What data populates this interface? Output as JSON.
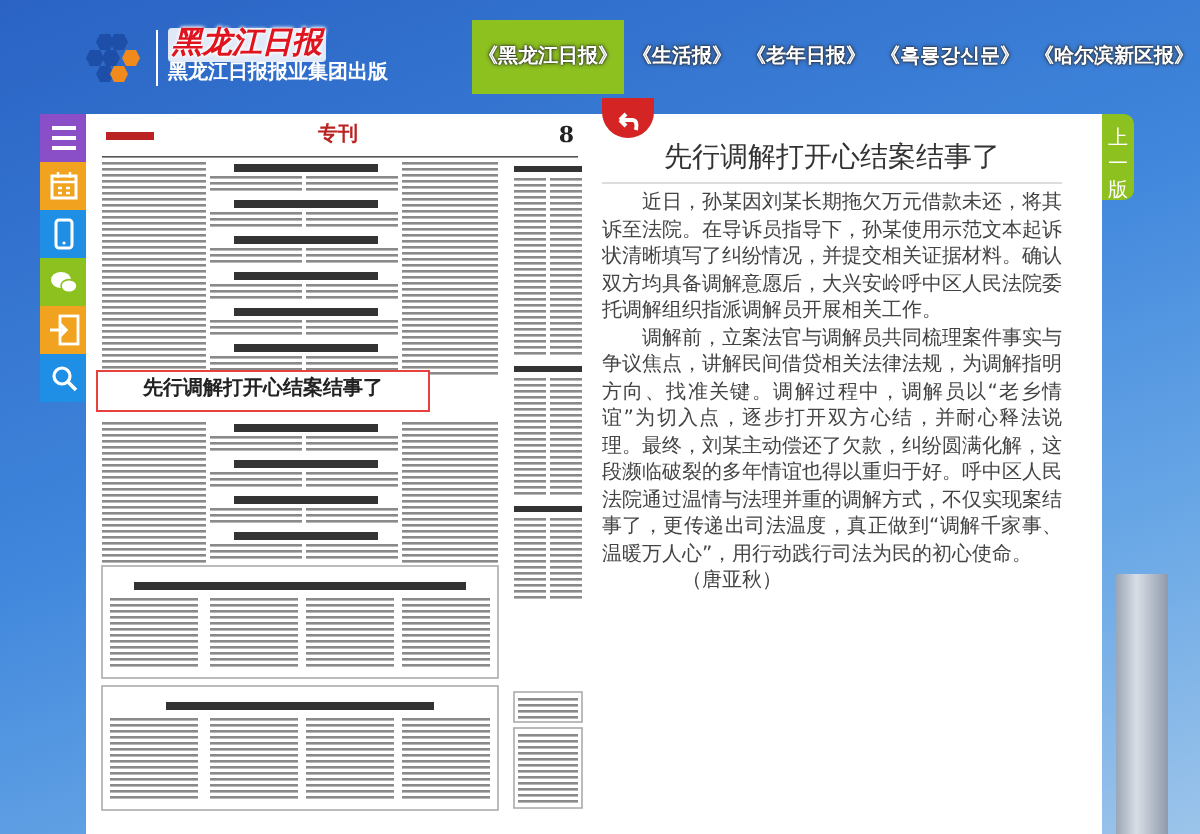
{
  "header": {
    "logo_title": "黑龙江日报",
    "logo_subtitle": "黑龙江日报报业集团出版"
  },
  "nav": [
    {
      "label": "《黑龙江日报》",
      "selected": true
    },
    {
      "label": "《生活报》",
      "selected": false
    },
    {
      "label": "《老年日报》",
      "selected": false
    },
    {
      "label": "《흑룡강신문》",
      "selected": false
    },
    {
      "label": "《哈尔滨新区报》",
      "selected": false
    }
  ],
  "toolbar": [
    {
      "kind": "menu"
    },
    {
      "kind": "calendar"
    },
    {
      "kind": "phone"
    },
    {
      "kind": "wechat"
    },
    {
      "kind": "past"
    },
    {
      "kind": "search"
    }
  ],
  "newspaper": {
    "section": "专刊",
    "page_number": "8",
    "highlighted_headline": "先行调解打开心结案结事了"
  },
  "article": {
    "title": "先行调解打开心结案结事了",
    "paragraphs": [
      "近日，孙某因刘某长期拖欠万元借款未还，将其诉至法院。在导诉员指导下，孙某使用示范文本起诉状清晰填写了纠纷情况，并提交相关证据材料。确认双方均具备调解意愿后，大兴安岭呼中区人民法院委托调解组织指派调解员开展相关工作。",
      "调解前，立案法官与调解员共同梳理案件事实与争议焦点，讲解民间借贷相关法律法规，为调解指明方向、找准关键。调解过程中，调解员以“老乡情谊”为切入点，逐步打开双方心结，并耐心释法说理。最终，刘某主动偿还了欠款，纠纷圆满化解，这段濒临破裂的多年情谊也得以重归于好。呼中区人民法院通过温情与法理并重的调解方式，不仅实现案结事了，更传递出司法温度，真正做到“调解千家事、温暖万人心”，用行动践行司法为民的初心使命。"
    ],
    "byline": "（唐亚秋）"
  },
  "page_nav": {
    "label": "上一版"
  }
}
